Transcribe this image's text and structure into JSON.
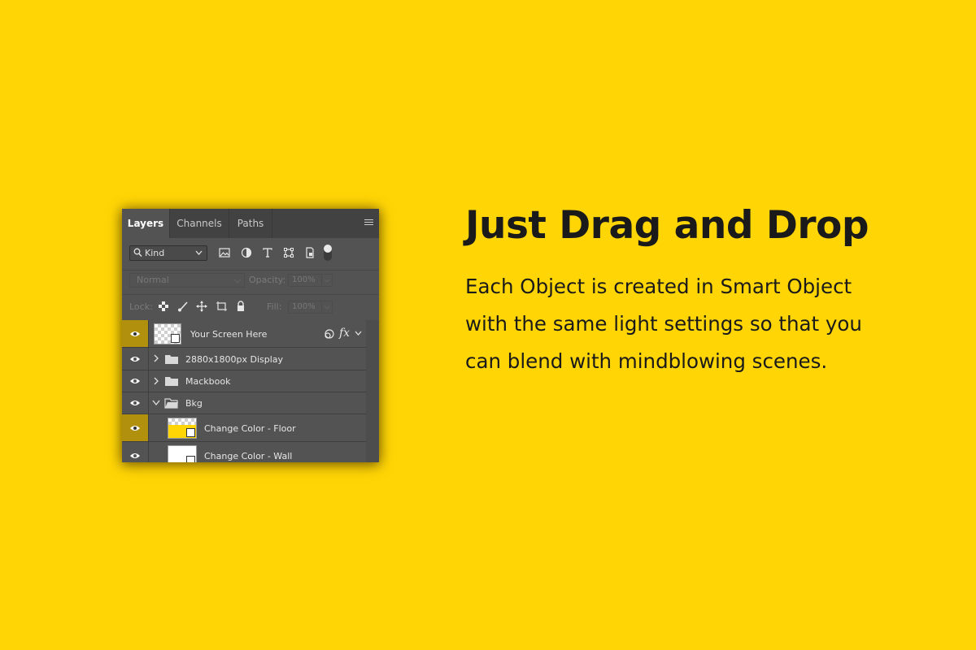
{
  "panel": {
    "tabs": [
      {
        "label": "Layers",
        "active": true
      },
      {
        "label": "Channels",
        "active": false
      },
      {
        "label": "Paths",
        "active": false
      }
    ],
    "filter": {
      "kind_label": "Kind",
      "icons": [
        "image-filter-icon",
        "adjustment-filter-icon",
        "type-filter-icon",
        "shape-filter-icon",
        "smart-object-filter-icon"
      ]
    },
    "blend": {
      "mode": "Normal",
      "opacity_label": "Opacity:",
      "opacity_value": "100%",
      "lock_label": "Lock:",
      "fill_label": "Fill:",
      "fill_value": "100%"
    },
    "layers": [
      {
        "name": "Your Screen Here",
        "kind": "smart-object",
        "highlighted": true,
        "fx": "fx"
      },
      {
        "name": "2880x1800px Display",
        "kind": "group-collapsed",
        "highlighted": false
      },
      {
        "name": "Mackbook",
        "kind": "group-collapsed",
        "highlighted": false
      },
      {
        "name": "Bkg",
        "kind": "group-expanded",
        "highlighted": false
      },
      {
        "name": "Change Color  - Floor",
        "kind": "smart-object",
        "highlighted": true
      },
      {
        "name": "Change Color - Wall",
        "kind": "smart-object",
        "highlighted": false
      }
    ]
  },
  "promo": {
    "headline": "Just Drag and Drop",
    "body": "Each Object is created in Smart Object with the same light settings so that you can blend with mindblowing scenes."
  },
  "colors": {
    "background": "#FFD505",
    "panel": "#535353",
    "highlight": "#B0900C",
    "text_dark": "#1A1A1A"
  }
}
